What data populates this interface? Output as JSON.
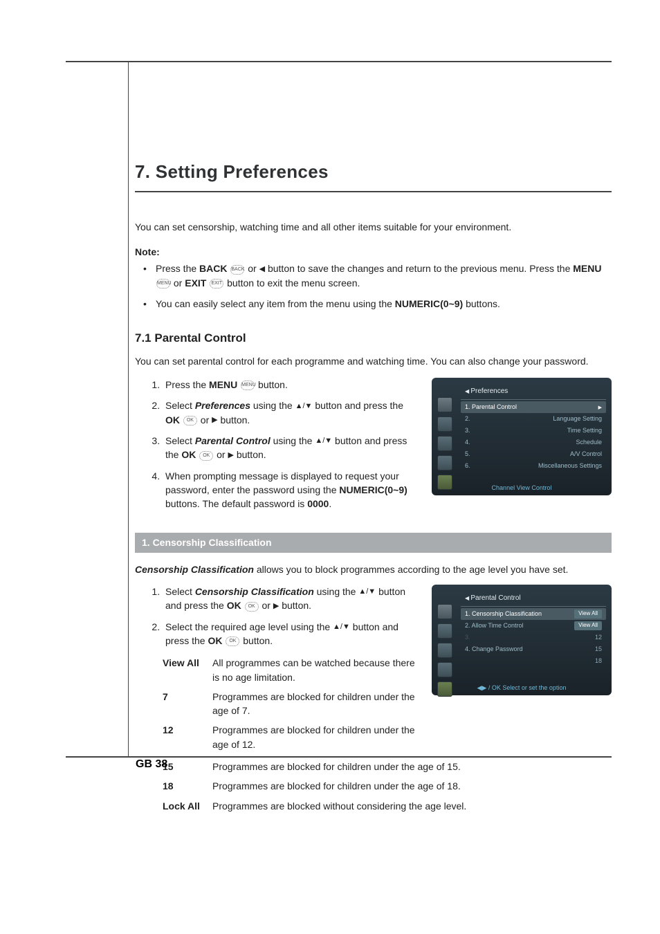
{
  "title": "7. Setting Preferences",
  "intro": "You can set censorship, watching time and all other items suitable for your environment.",
  "note_label": "Note:",
  "note_bullets": {
    "b1_pre": "Press the ",
    "b1_back": "BACK",
    "b1_mid1": " or ",
    "b1_post1": " button to save the changes and return to the previous menu. Press the ",
    "b1_menu": "MENU",
    "b1_mid2": " or ",
    "b1_exit": "EXIT",
    "b1_post2": " button to exit the menu screen.",
    "b2_pre": "You can easily select any item from the menu using the ",
    "b2_num": "NUMERIC(0~9)",
    "b2_post": " buttons."
  },
  "section1": {
    "heading": "7.1 Parental Control",
    "desc": "You can set parental control for each programme and watching time. You can also change your password.",
    "steps": {
      "s1_pre": "Press the ",
      "s1_menu": "MENU",
      "s1_post": " button.",
      "s2_pre": "Select ",
      "s2_pref": "Preferences",
      "s2_mid": " using the ",
      "s2_mid2": " button and press the ",
      "s2_ok": "OK",
      "s2_mid3": " or ",
      "s2_post": " button.",
      "s3_pre": "Select ",
      "s3_pc": "Parental Control",
      "s3_mid": " using the ",
      "s3_mid2": " button and press the ",
      "s3_ok": "OK",
      "s3_mid3": " or ",
      "s3_post": " button.",
      "s4_pre": "When prompting message is displayed to request your password, enter the password using the ",
      "s4_num": "NUMERIC(0~9)",
      "s4_mid": " buttons. The default password is ",
      "s4_pwd": "0000",
      "s4_post": "."
    }
  },
  "screenshot1": {
    "header": "Preferences",
    "items": [
      "Parental Control",
      "Language Setting",
      "Time Setting",
      "Schedule",
      "A/V Control",
      "Miscellaneous Settings"
    ],
    "bottom": "Channel View Control"
  },
  "subheader1": "1. Censorship Classification",
  "cc": {
    "desc_strong": "Censorship Classification",
    "desc_rest": " allows you to block programmes according to the age level you have set.",
    "steps": {
      "s1_pre": "Select ",
      "s1_cc": "Censorship Classification",
      "s1_mid": " using the ",
      "s1_mid2": " button and press the ",
      "s1_ok": "OK",
      "s1_mid3": " or ",
      "s1_post": " button.",
      "s2_pre": "Select the required age level using the ",
      "s2_mid": " button and press the ",
      "s2_ok": "OK",
      "s2_post": " button."
    }
  },
  "screenshot2": {
    "header": "Parental Control",
    "items": [
      {
        "label": "Censorship Classification",
        "value": "View All"
      },
      {
        "label": "Allow Time Control",
        "value": "View All"
      },
      {
        "label": "",
        "value": ""
      },
      {
        "label": "Change Password",
        "value": ""
      }
    ],
    "nums": [
      "12",
      "15",
      "18"
    ],
    "bottom": "◀▶ / OK Select or set the option"
  },
  "defs": [
    {
      "term": "View All",
      "desc": "All programmes can be watched because there is no age limitation."
    },
    {
      "term": "7",
      "desc": "Programmes are blocked for children under the age of 7."
    },
    {
      "term": "12",
      "desc": "Programmes are blocked for children under the age of 12."
    },
    {
      "term": "15",
      "desc": "Programmes are blocked for children under the age of 15."
    },
    {
      "term": "18",
      "desc": "Programmes are blocked for children under the age of 18."
    },
    {
      "term": "Lock All",
      "desc": "Programmes are blocked without considering the age level."
    }
  ],
  "page_num": "GB 38",
  "icons": {
    "back": "BACK",
    "menu": "MENU",
    "exit": "EXIT",
    "ok": "OK"
  }
}
